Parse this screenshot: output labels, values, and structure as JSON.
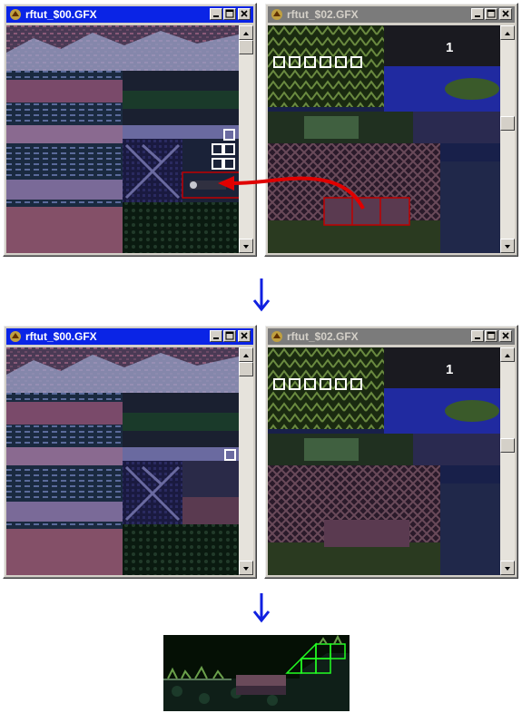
{
  "windows": [
    {
      "title": "rftut_$00.GFX",
      "state": "active",
      "buttons": [
        "minimize",
        "maximize",
        "close"
      ]
    },
    {
      "title": "rftut_$02.GFX",
      "state": "inactive",
      "buttons": [
        "minimize",
        "maximize",
        "close"
      ]
    },
    {
      "title": "rftut_$00.GFX",
      "state": "active",
      "buttons": [
        "minimize",
        "maximize",
        "close"
      ]
    },
    {
      "title": "rftut_$02.GFX",
      "state": "inactive",
      "buttons": [
        "minimize",
        "maximize",
        "close"
      ]
    }
  ],
  "tile_label": "1",
  "icons": {
    "window": "window-app-icon",
    "flow": "down-arrow-icon",
    "drag": "red-curved-arrow-icon"
  },
  "colors": {
    "active_title": "#0a24e6",
    "inactive_title": "#7b7b7b",
    "flow_arrow": "#1020e0",
    "drag_arrow": "#e00000",
    "selection": "#c00000",
    "tile_outline": "#ffffff",
    "level_outline": "#00ff00"
  }
}
